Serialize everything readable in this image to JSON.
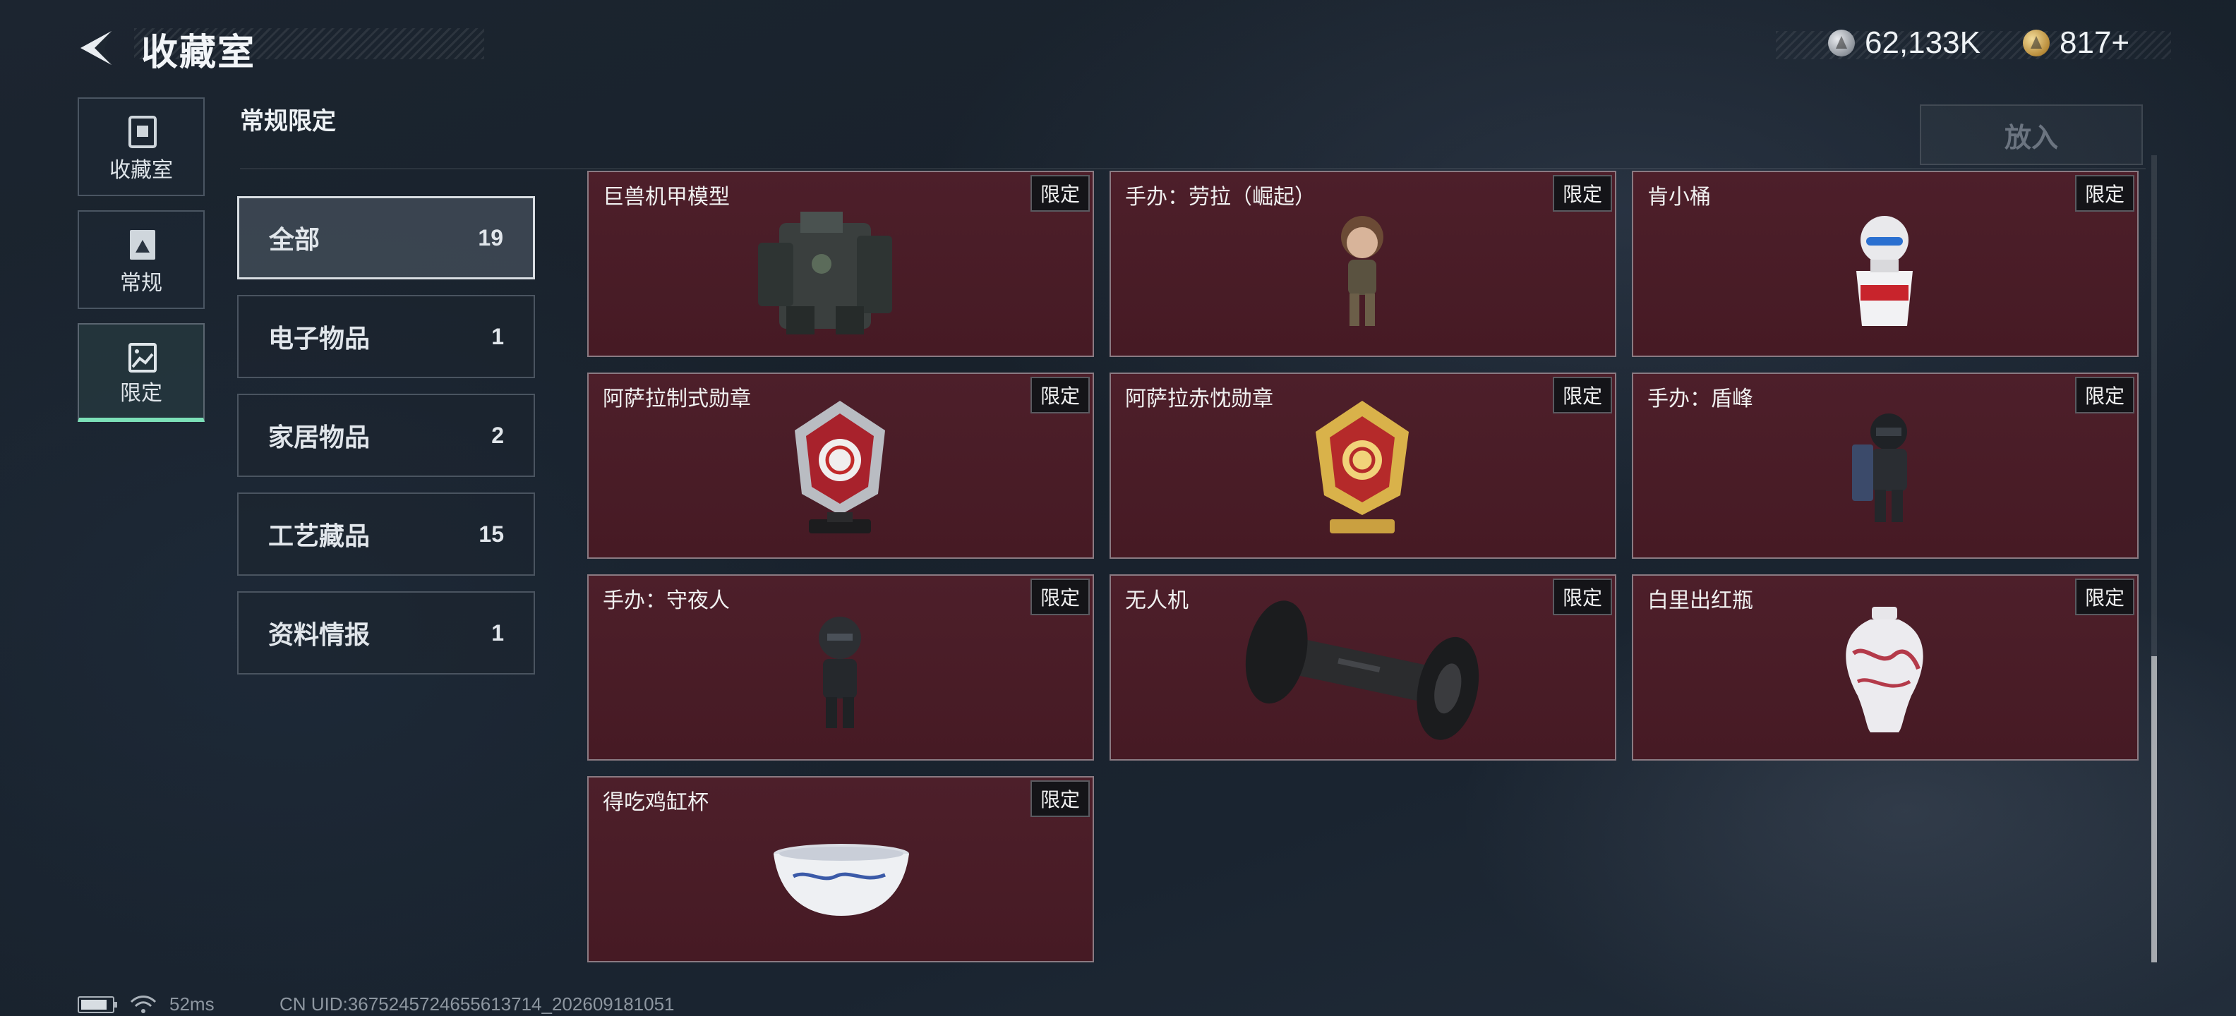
{
  "header": {
    "title": "收藏室",
    "currency_silver": "62,133K",
    "currency_gold": "817+"
  },
  "rail": {
    "items": [
      {
        "label": "收藏室",
        "icon": "storage-box-icon"
      },
      {
        "label": "常规",
        "icon": "image-frame-icon"
      },
      {
        "label": "限定",
        "icon": "landscape-icon",
        "active": true
      }
    ]
  },
  "section": {
    "title": "常规限定",
    "put_label": "放入"
  },
  "categories": [
    {
      "name": "全部",
      "count": "19",
      "selected": true
    },
    {
      "name": "电子物品",
      "count": "1"
    },
    {
      "name": "家居物品",
      "count": "2"
    },
    {
      "name": "工艺藏品",
      "count": "15"
    },
    {
      "name": "资料情报",
      "count": "1"
    }
  ],
  "badge_label": "限定",
  "items": [
    {
      "name": "巨兽机甲模型",
      "badge": "限定",
      "icon": "mech-model"
    },
    {
      "name": "手办：劳拉（崛起）",
      "badge": "限定",
      "icon": "figure-lara"
    },
    {
      "name": "肯小桶",
      "badge": "限定",
      "icon": "kfc-bucket-figure"
    },
    {
      "name": "阿萨拉制式勋章",
      "badge": "限定",
      "icon": "silver-medal"
    },
    {
      "name": "阿萨拉赤忱勋章",
      "badge": "限定",
      "icon": "gold-medal"
    },
    {
      "name": "手办：盾峰",
      "badge": "限定",
      "icon": "figure-shield"
    },
    {
      "name": "手办：守夜人",
      "badge": "限定",
      "icon": "figure-nightwatch"
    },
    {
      "name": "无人机",
      "badge": "限定",
      "icon": "drone-roller"
    },
    {
      "name": "白里出红瓶",
      "badge": "限定",
      "icon": "porcelain-vase"
    },
    {
      "name": "得吃鸡缸杯",
      "badge": "限定",
      "icon": "porcelain-cup"
    }
  ],
  "status": {
    "ping": "52ms",
    "uid": "CN UID:3675245724655613714_202609181051"
  },
  "colors": {
    "card_bg": "#4d1f2a",
    "accent_active": "#7ce0b8"
  }
}
